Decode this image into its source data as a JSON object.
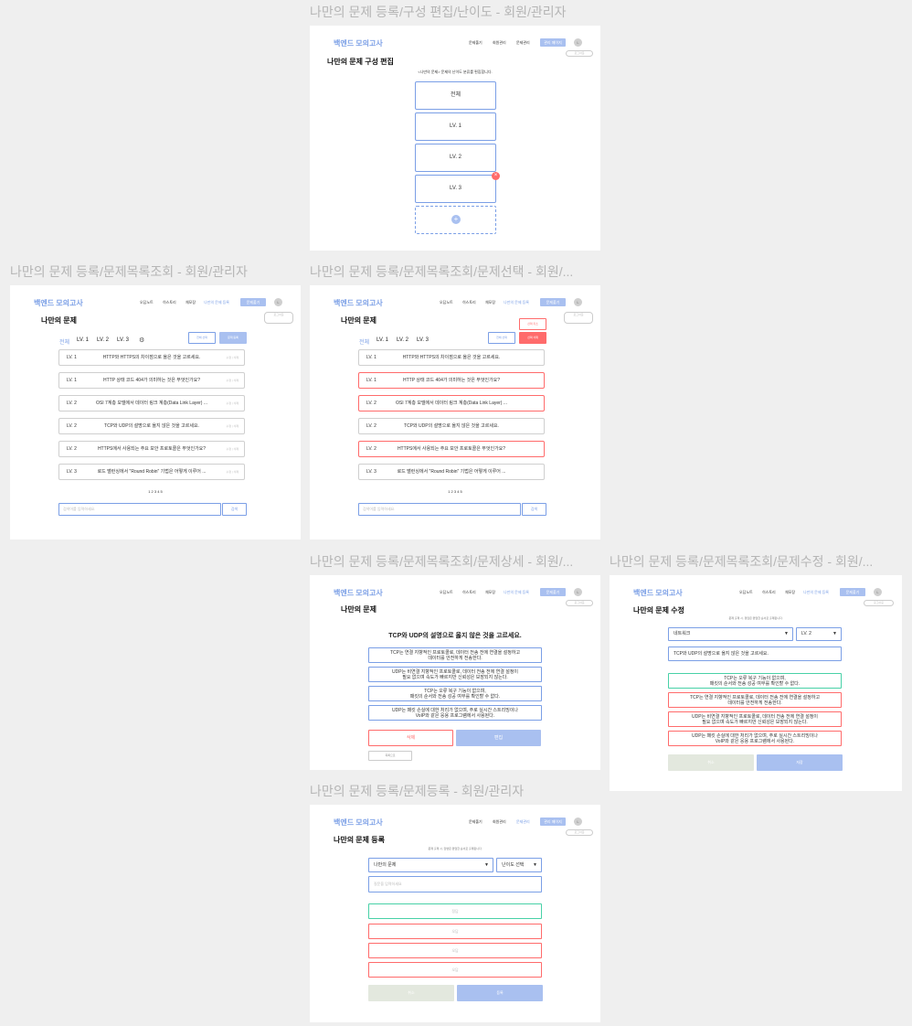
{
  "nav": {
    "logo": "백엔드 모의고사",
    "items": [
      "오답노트",
      "히스토리",
      "체모장",
      "나만의 문제 등록"
    ],
    "cta": "문제풀기",
    "avatar": "L",
    "logout": "로그아웃"
  },
  "frames": {
    "edit": {
      "caption": "나만의 문제 등록/구성 편집/난이도 - 회원/관리자",
      "nav": [
        "문제풀기",
        "회원관리",
        "문제관리"
      ],
      "cta": "관리 페이지",
      "heading": "나만의 문제 구성 편집",
      "subtitle": "<나만의 문제> 문제의 난이도 분류를 편집합니다.",
      "levels": [
        "전체",
        "LV. 1",
        "LV. 2",
        "LV. 3"
      ],
      "plus": "+",
      "delete": "×"
    },
    "list": {
      "caption": "나만의 문제 등록/문제목록조회 - 회원/관리자",
      "heading": "나만의 문제",
      "tabs": [
        "전체",
        "LV. 1",
        "LV. 2",
        "LV. 3"
      ],
      "settings_icon": "gear-icon",
      "btn_select": "전체 선택",
      "btn_register": "문제 등록",
      "row_actions": "수정 | 삭제",
      "rows": [
        {
          "level": "LV. 1",
          "text": "HTTP와 HTTPS의 차이점으로 옳은 것을 고르세요."
        },
        {
          "level": "LV. 1",
          "text": "HTTP 상태 코드 404가 의미하는 것은 무엇인가요?"
        },
        {
          "level": "LV. 2",
          "text": "OSI 7계층 모델에서 데이터 링크 계층(Data Link Layer) ..."
        },
        {
          "level": "LV. 2",
          "text": "TCP와 UDP의 설명으로 옳지 않은 것을 고르세요."
        },
        {
          "level": "LV. 2",
          "text": "HTTPS에서 사용되는 주요 보안 프로토콜은 무엇인가요?"
        },
        {
          "level": "LV. 3",
          "text": "로드 밸런싱에서 \"Round Robin\" 기법은 어떻게 이루어 ..."
        }
      ],
      "pages": "1  2  3  4  5",
      "search_placeholder": "검색어를 입력하세요.",
      "search_btn": "검색"
    },
    "select": {
      "caption": "나만의 문제 등록/문제목록조회/문제선택 - 회원/...",
      "btn_cancel": "선택 취소",
      "btn_delete": "선택 삭제",
      "btn_select": "전체 선택",
      "selected_rows": [
        1,
        2,
        4
      ],
      "rows": [
        {
          "level": "LV. 1",
          "text": "HTTP와 HTTPS의 차이점으로 옳은 것을 고르세요."
        },
        {
          "level": "LV. 1",
          "text": "HTTP 상태 코드 404가 의미하는 것은 무엇인가요?"
        },
        {
          "level": "LV. 2",
          "text": "OSI 7계층 모델에서 데이터 링크 계층(Data Link Layer) ..."
        },
        {
          "level": "LV. 2",
          "text": "TCP와 UDP의 설명으로 옳지 않은 것을 고르세요."
        },
        {
          "level": "LV. 2",
          "text": "HTTPS에서 사용되는 주요 보안 프로토콜은 무엇인가요?"
        },
        {
          "level": "LV. 3",
          "text": "로드 밸런싱에서 \"Round Robin\" 기법은 어떻게 이루어 ..."
        }
      ]
    },
    "detail": {
      "caption": "나만의 문제 등록/문제목록조회/문제상세 - 회원/...",
      "heading": "나만의 문제",
      "question": "TCP와 UDP의 설명으로 옳지 않은 것을 고르세요.",
      "options": [
        [
          "TCP는 연결 지향적인 프로토콜로, 데이터 전송 전에 연결을 설정하고",
          "데이터를 안전하게 전송한다."
        ],
        [
          "UDP는 비연결 지향적인 프로토콜로, 데이터 전송 전에 연결 설정이",
          "필요 없으며 속도가 빠르지만 신뢰성은 보장되지 않는다."
        ],
        [
          "TCP는 오류 복구 기능이 없으며,",
          "패킷의 순서와 전송 성공 여부를 확인할 수 없다."
        ],
        [
          "UDP는 패킷 손실에 대한 처리가 없으며, 주로 실시간 스트리밍이나",
          "VoIP와 같은 응용 프로그램에서 사용된다."
        ]
      ],
      "btn_delete": "삭제",
      "btn_edit": "편집",
      "btn_back": "목록으로"
    },
    "edit_q": {
      "caption": "나만의 문제 등록/문제목록조회/문제수정 - 회원/...",
      "heading": "나만의 문제 수정",
      "subtitle": "문제 출제 시, 정답은 랜덤한 순서로 출제됩니다.",
      "category": "네트워크",
      "level": "LV. 2",
      "question": "TCP와 UDP의 설명으로 옳지 않은 것을 고르세요.",
      "options": [
        [
          "TCP는 오류 복구 기능이 없으며,",
          "패킷의 순서와 전송 성공 여부를 확인할 수 없다."
        ],
        [
          "TCP는 연결 지향적인 프로토콜로, 데이터 전송 전에 연결을 설정하고",
          "데이터를 안전하게 전송한다."
        ],
        [
          "UDP는 비연결 지향적인 프로토콜로, 데이터 전송 전에 연결 설정이",
          "필요 없으며 속도가 빠르지만 신뢰성은 보장되지 않는다."
        ],
        [
          "UDP는 패킷 손실에 대한 처리가 없으며, 주로 실시간 스트리밍이나",
          "VoIP와 같은 응용 프로그램에서 사용된다."
        ]
      ],
      "btn_cancel": "취소",
      "btn_save": "저장"
    },
    "register": {
      "caption": "나만의 문제 등록/문제등록 - 회원/관리자",
      "nav": [
        "문제풀기",
        "회원관리",
        "문제관리"
      ],
      "cta": "관리 페이지",
      "heading": "나만의 문제 등록",
      "subtitle": "문제 출제 시, 답변은 랜덤한 순서로 출제됩니다.",
      "category": "나만의 문제",
      "level": "난이도 선택",
      "question_placeholder": "질문을 입력하세요",
      "correct": "정답",
      "wrong": "오답",
      "btn_cancel": "취소",
      "btn_register": "등록"
    }
  },
  "colors": {
    "accent": "#7b9fe6",
    "danger": "#ff6b6b",
    "correct": "#48d1a7"
  }
}
